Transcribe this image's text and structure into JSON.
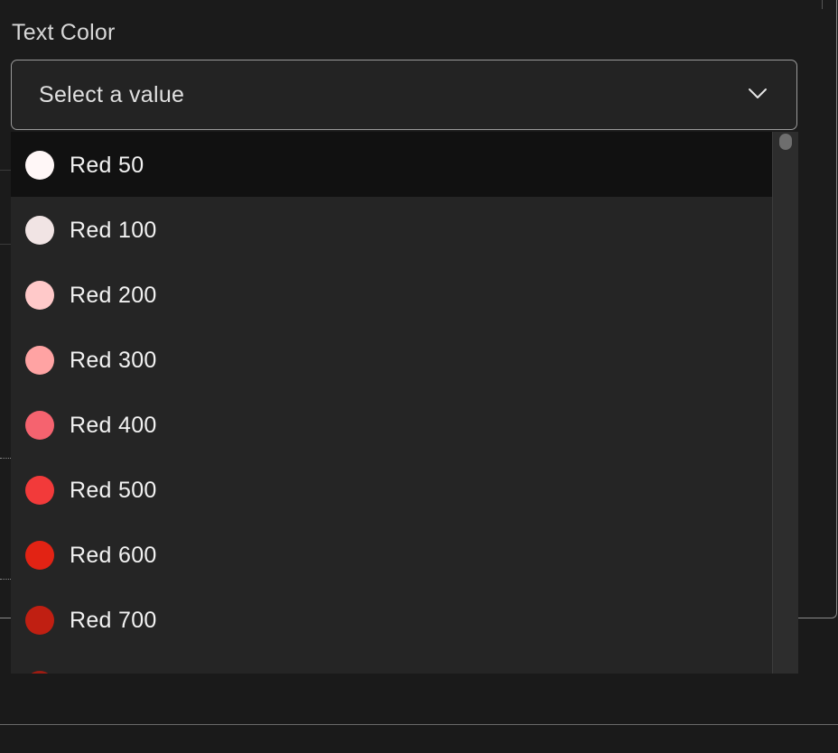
{
  "field": {
    "label": "Text Color",
    "placeholder": "Select a value"
  },
  "options": [
    {
      "label": "Red 50",
      "color": "#fff7f7",
      "highlighted": true
    },
    {
      "label": "Red 100",
      "color": "#f1e4e4",
      "highlighted": false
    },
    {
      "label": "Red 200",
      "color": "#ffc9c9",
      "highlighted": false
    },
    {
      "label": "Red 300",
      "color": "#ffa3a3",
      "highlighted": false
    },
    {
      "label": "Red 400",
      "color": "#f5636f",
      "highlighted": false
    },
    {
      "label": "Red 500",
      "color": "#f23a3a",
      "highlighted": false
    },
    {
      "label": "Red 600",
      "color": "#e22314",
      "highlighted": false
    },
    {
      "label": "Red 700",
      "color": "#c01f12",
      "highlighted": false
    },
    {
      "label": "",
      "color": "#9d1c12",
      "highlighted": false
    }
  ],
  "icons": {
    "dropdown_chevron": "chevron-down-icon"
  }
}
